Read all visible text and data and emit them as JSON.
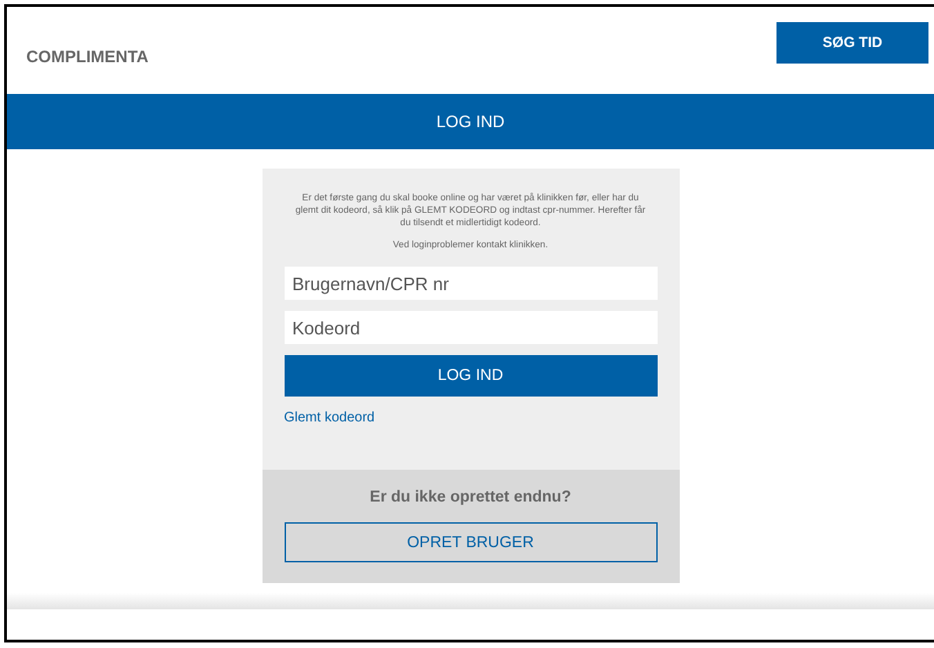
{
  "header": {
    "brand": "COMPLIMENTA",
    "book_button": "SØG TID"
  },
  "title_bar": {
    "title": "LOG IND"
  },
  "login": {
    "intro": "Er det første gang du skal booke online og har været på klinikken før, eller har du glemt dit kodeord, så klik på GLEMT KODEORD og indtast cpr-nummer. Herefter får du tilsendt et midlertidigt kodeord.",
    "help": "Ved loginproblemer kontakt klinikken.",
    "username": {
      "placeholder": "Brugernavn/CPR nr"
    },
    "password": {
      "placeholder": "Kodeord"
    },
    "submit": "LOG IND",
    "forgot_link": "Glemt kodeord"
  },
  "signup": {
    "question": "Er du ikke oprettet endnu?",
    "button": "OPRET BRUGER"
  }
}
